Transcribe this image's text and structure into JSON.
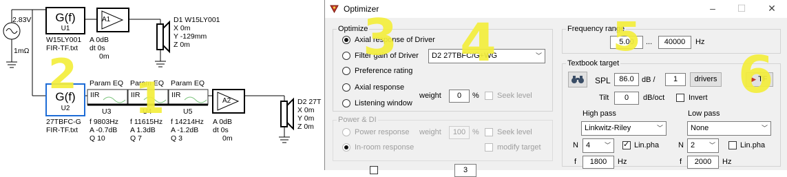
{
  "schematic": {
    "source_voltage": "2.83V",
    "source_resistance": "1mΩ",
    "top_chain": {
      "filter_label": "G(f)",
      "filter_id": "U1",
      "filter_name": "W15LY001",
      "filter_file": "FIR-TF.txt",
      "amp_label": "A1",
      "amp_gain": "A 0dB",
      "amp_delay": "dt 0s",
      "amp_extra": "0m"
    },
    "driver1": {
      "title": "D1 W15LY001",
      "x": "X 0m",
      "y": "Y -129mm",
      "z": "Z 0m"
    },
    "bottom_chain": {
      "filter_label": "G(f)",
      "filter_id": "U2",
      "filter_name": "27TBFC-G",
      "filter_file": "FIR-TF.txt",
      "eqs": [
        {
          "header": "Param EQ",
          "type": "IIR",
          "id": "U3",
          "f": "f   9803Hz",
          "a": "A  -0.7dB",
          "q": "Q  10"
        },
        {
          "header": "Param EQ",
          "type": "IIR",
          "id": "U4",
          "f": "f   11615Hz",
          "a": "A  1.3dB",
          "q": "Q  7"
        },
        {
          "header": "Param EQ",
          "type": "IIR",
          "id": "U5",
          "f": "f   14214Hz",
          "a": "A  -1.2dB",
          "q": "Q  3"
        }
      ],
      "amp_label": "A2",
      "amp_gain": "A 0dB",
      "amp_delay": "dt 0s",
      "amp_extra": "0m"
    },
    "driver2": {
      "title": "D2 27T",
      "x": "X 0m",
      "y": "Y 0m",
      "z": "Z 0m"
    },
    "highlights": [
      "2",
      "1"
    ]
  },
  "window": {
    "title": "Optimizer",
    "optimize": {
      "label": "Optimize",
      "options": [
        {
          "label": "Axial response of Driver",
          "selected": true
        },
        {
          "label": "Filter gain of Driver",
          "selected": false
        },
        {
          "label": "Preference rating",
          "selected": false
        },
        {
          "label": "Axial response",
          "selected": false
        },
        {
          "label": "Listening window",
          "selected": false
        }
      ],
      "driver_select": "D2 27TBFC/G+WG",
      "weight_label": "weight",
      "weight_value": "0",
      "weight_unit": "%",
      "seek_level": "Seek level"
    },
    "power_di": {
      "label": "Power & DI",
      "options": [
        {
          "label": "Power response",
          "selected": false
        },
        {
          "label": "In-room response",
          "selected": true
        }
      ],
      "weight_label": "weight",
      "weight_value": "100",
      "weight_unit": "%",
      "seek_level": "Seek level",
      "modify_target": "modify target"
    },
    "minimum_value": "3",
    "frequency_range": {
      "label": "Frequency range",
      "from": "5.00",
      "sep": "...",
      "to": "40000",
      "unit": "Hz"
    },
    "textbook_target": {
      "label": "Textbook target",
      "spl_label": "SPL",
      "spl_value": "86.0",
      "spl_unit": "dB /",
      "drivers_count": "1",
      "drivers_button": "drivers",
      "tf_button": "TF",
      "tilt_label": "Tilt",
      "tilt_value": "0",
      "tilt_unit": "dB/oct",
      "invert_label": "Invert",
      "high_pass": {
        "label": "High pass",
        "type": "Linkwitz-Riley",
        "n_label": "N",
        "order": "4",
        "lin_pha": "Lin.pha",
        "lin_pha_checked": true,
        "f_label": "f",
        "freq": "1800",
        "unit": "Hz"
      },
      "low_pass": {
        "label": "Low pass",
        "type": "None",
        "n_label": "N",
        "order": "2",
        "lin_pha": "Lin.pha",
        "lin_pha_checked": false,
        "f_label": "f",
        "freq": "2000",
        "unit": "Hz"
      }
    },
    "highlights": [
      "3",
      "4",
      "5",
      "6"
    ]
  },
  "colors": {
    "highlight": "#f4ee3c",
    "selection_blue": "#1c6bd6",
    "title_icon": "#c0392b"
  }
}
